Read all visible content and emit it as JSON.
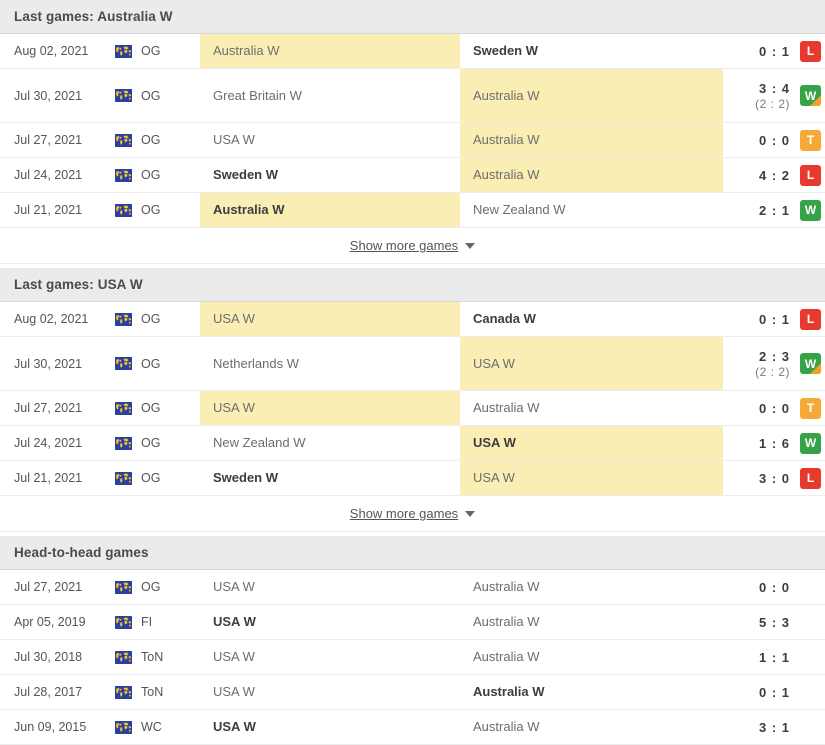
{
  "colors": {
    "header_bg": "#ebebeb",
    "highlight": "#fbeeb5",
    "win": "#37a349",
    "loss": "#e8392e",
    "tie": "#f5aa38",
    "extra_corner": "#f3a229",
    "comp_icon_bg": "#2a3f9e",
    "comp_icon_fg": "#f2c230"
  },
  "sections": [
    {
      "id": "last-games-australia",
      "title": "Last games: Australia W",
      "show_more_label": "Show more games",
      "has_show_more": true,
      "has_badges": true,
      "games": [
        {
          "date": "Aug 02, 2021",
          "competition": "OG",
          "competition_icon": "world-map-icon",
          "home": "Australia W",
          "away": "Sweden W",
          "home_bold": false,
          "away_bold": true,
          "home_highlight": true,
          "away_highlight": false,
          "score": "0 : 1",
          "halftime": "",
          "badge": "L",
          "badge_type": "loss",
          "badge_extra": false
        },
        {
          "date": "Jul 30, 2021",
          "competition": "OG",
          "competition_icon": "world-map-icon",
          "home": "Great Britain W",
          "away": "Australia W",
          "home_bold": false,
          "away_bold": false,
          "home_highlight": false,
          "away_highlight": true,
          "score": "3 : 4",
          "halftime": "(2 : 2)",
          "badge": "W",
          "badge_type": "win",
          "badge_extra": true
        },
        {
          "date": "Jul 27, 2021",
          "competition": "OG",
          "competition_icon": "world-map-icon",
          "home": "USA W",
          "away": "Australia W",
          "home_bold": false,
          "away_bold": false,
          "home_highlight": false,
          "away_highlight": true,
          "score": "0 : 0",
          "halftime": "",
          "badge": "T",
          "badge_type": "tie",
          "badge_extra": false
        },
        {
          "date": "Jul 24, 2021",
          "competition": "OG",
          "competition_icon": "world-map-icon",
          "home": "Sweden W",
          "away": "Australia W",
          "home_bold": true,
          "away_bold": false,
          "home_highlight": false,
          "away_highlight": true,
          "score": "4 : 2",
          "halftime": "",
          "badge": "L",
          "badge_type": "loss",
          "badge_extra": false
        },
        {
          "date": "Jul 21, 2021",
          "competition": "OG",
          "competition_icon": "world-map-icon",
          "home": "Australia W",
          "away": "New Zealand W",
          "home_bold": true,
          "away_bold": false,
          "home_highlight": true,
          "away_highlight": false,
          "score": "2 : 1",
          "halftime": "",
          "badge": "W",
          "badge_type": "win",
          "badge_extra": false
        }
      ]
    },
    {
      "id": "last-games-usa",
      "title": "Last games: USA W",
      "show_more_label": "Show more games",
      "has_show_more": true,
      "has_badges": true,
      "games": [
        {
          "date": "Aug 02, 2021",
          "competition": "OG",
          "competition_icon": "world-map-icon",
          "home": "USA W",
          "away": "Canada W",
          "home_bold": false,
          "away_bold": true,
          "home_highlight": true,
          "away_highlight": false,
          "score": "0 : 1",
          "halftime": "",
          "badge": "L",
          "badge_type": "loss",
          "badge_extra": false
        },
        {
          "date": "Jul 30, 2021",
          "competition": "OG",
          "competition_icon": "world-map-icon",
          "home": "Netherlands W",
          "away": "USA W",
          "home_bold": false,
          "away_bold": false,
          "home_highlight": false,
          "away_highlight": true,
          "score": "2 : 3",
          "halftime": "(2 : 2)",
          "badge": "W",
          "badge_type": "win",
          "badge_extra": true
        },
        {
          "date": "Jul 27, 2021",
          "competition": "OG",
          "competition_icon": "world-map-icon",
          "home": "USA W",
          "away": "Australia W",
          "home_bold": false,
          "away_bold": false,
          "home_highlight": true,
          "away_highlight": false,
          "score": "0 : 0",
          "halftime": "",
          "badge": "T",
          "badge_type": "tie",
          "badge_extra": false
        },
        {
          "date": "Jul 24, 2021",
          "competition": "OG",
          "competition_icon": "world-map-icon",
          "home": "New Zealand W",
          "away": "USA W",
          "home_bold": false,
          "away_bold": true,
          "home_highlight": false,
          "away_highlight": true,
          "score": "1 : 6",
          "halftime": "",
          "badge": "W",
          "badge_type": "win",
          "badge_extra": false
        },
        {
          "date": "Jul 21, 2021",
          "competition": "OG",
          "competition_icon": "world-map-icon",
          "home": "Sweden W",
          "away": "USA W",
          "home_bold": true,
          "away_bold": false,
          "home_highlight": false,
          "away_highlight": true,
          "score": "3 : 0",
          "halftime": "",
          "badge": "L",
          "badge_type": "loss",
          "badge_extra": false
        }
      ]
    },
    {
      "id": "head-to-head",
      "title": "Head-to-head games",
      "show_more_label": "",
      "has_show_more": false,
      "has_badges": false,
      "games": [
        {
          "date": "Jul 27, 2021",
          "competition": "OG",
          "competition_icon": "world-map-icon",
          "home": "USA W",
          "away": "Australia W",
          "home_bold": false,
          "away_bold": false,
          "home_highlight": false,
          "away_highlight": false,
          "score": "0 : 0",
          "halftime": "",
          "badge": "",
          "badge_type": "",
          "badge_extra": false
        },
        {
          "date": "Apr 05, 2019",
          "competition": "FI",
          "competition_icon": "world-map-icon",
          "home": "USA W",
          "away": "Australia W",
          "home_bold": true,
          "away_bold": false,
          "home_highlight": false,
          "away_highlight": false,
          "score": "5 : 3",
          "halftime": "",
          "badge": "",
          "badge_type": "",
          "badge_extra": false
        },
        {
          "date": "Jul 30, 2018",
          "competition": "ToN",
          "competition_icon": "world-map-icon",
          "home": "USA W",
          "away": "Australia W",
          "home_bold": false,
          "away_bold": false,
          "home_highlight": false,
          "away_highlight": false,
          "score": "1 : 1",
          "halftime": "",
          "badge": "",
          "badge_type": "",
          "badge_extra": false
        },
        {
          "date": "Jul 28, 2017",
          "competition": "ToN",
          "competition_icon": "world-map-icon",
          "home": "USA W",
          "away": "Australia W",
          "home_bold": false,
          "away_bold": true,
          "home_highlight": false,
          "away_highlight": false,
          "score": "0 : 1",
          "halftime": "",
          "badge": "",
          "badge_type": "",
          "badge_extra": false
        },
        {
          "date": "Jun 09, 2015",
          "competition": "WC",
          "competition_icon": "world-map-icon",
          "home": "USA W",
          "away": "Australia W",
          "home_bold": true,
          "away_bold": false,
          "home_highlight": false,
          "away_highlight": false,
          "score": "3 : 1",
          "halftime": "",
          "badge": "",
          "badge_type": "",
          "badge_extra": false
        }
      ]
    }
  ]
}
